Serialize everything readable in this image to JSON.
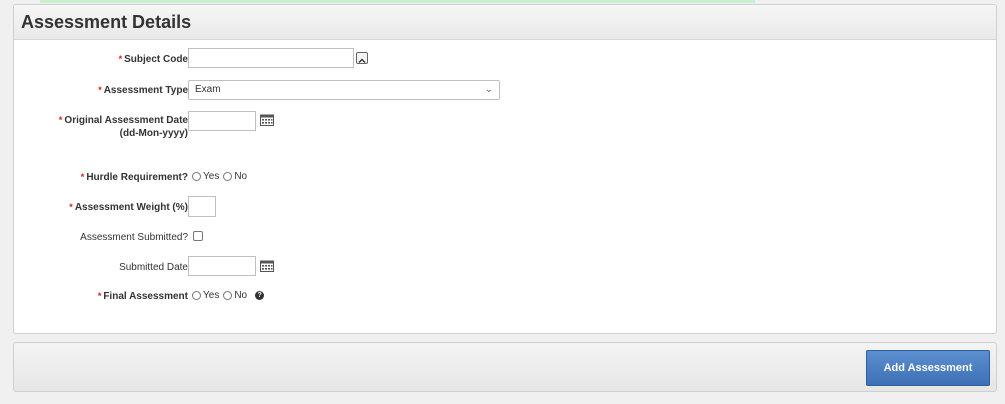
{
  "panel": {
    "title": "Assessment Details"
  },
  "form": {
    "required_mark": "*",
    "subject_code": {
      "label": "Subject Code",
      "value": ""
    },
    "assessment_type": {
      "label": "Assessment Type",
      "selected": "Exam"
    },
    "original_assessment_date": {
      "label": "Original Assessment Date",
      "label_sub": "(dd-Mon-yyyy)",
      "value": ""
    },
    "hurdle_requirement": {
      "label": "Hurdle Requirement?",
      "options": [
        "Yes",
        "No"
      ]
    },
    "assessment_weight": {
      "label": "Assessment Weight (%)",
      "value": ""
    },
    "assessment_submitted": {
      "label": "Assessment Submitted?",
      "checked": false
    },
    "submitted_date": {
      "label": "Submitted Date",
      "value": ""
    },
    "final_assessment": {
      "label": "Final Assessment",
      "options": [
        "Yes",
        "No"
      ]
    }
  },
  "footer": {
    "add_button_label": "Add Assessment"
  },
  "colors": {
    "accent": "#4a7cc0",
    "required": "#d02020"
  },
  "icons": {
    "lov": "chevron-up-icon",
    "calendar": "calendar-icon",
    "help": "help-icon"
  }
}
